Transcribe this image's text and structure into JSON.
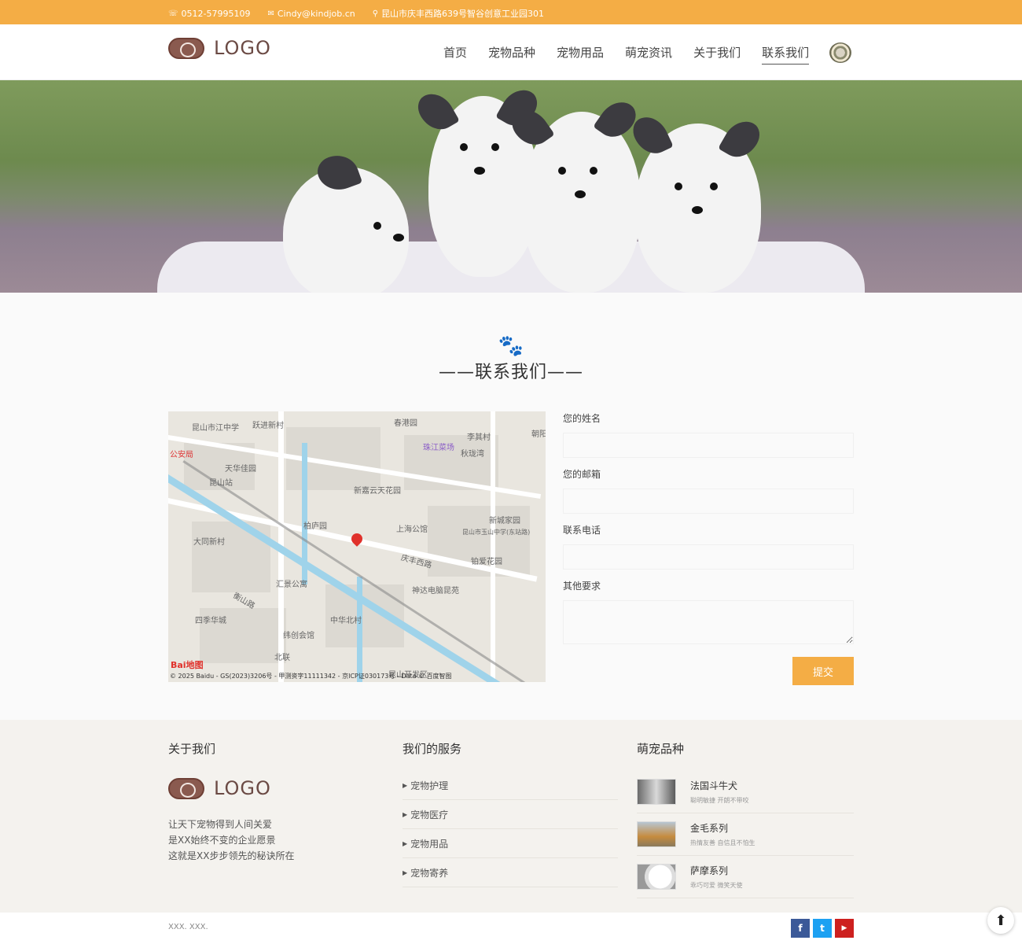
{
  "topbar": {
    "phone": "0512-57995109",
    "email": "Cindy@kindjob.cn",
    "address": "昆山市庆丰西路639号智谷创意工业园301",
    "phone_icon": "phone-icon",
    "email_icon": "mail-icon",
    "address_icon": "map-marker-icon"
  },
  "header": {
    "logo_text": "LOGO",
    "nav": [
      {
        "label": "首页"
      },
      {
        "label": "宠物品种"
      },
      {
        "label": "宠物用品"
      },
      {
        "label": "萌宠资讯"
      },
      {
        "label": "关于我们"
      },
      {
        "label": "联系我们",
        "active": true
      }
    ]
  },
  "section": {
    "title": "——联系我们——",
    "icon": "paw-icon"
  },
  "map": {
    "labels": [
      "昆山市江中学",
      "跃进新村",
      "春港园",
      "李其村",
      "朝阳",
      "公安局",
      "天华佳园",
      "秋珑湾",
      "珠江菜场",
      "昆山站",
      "新嘉云天花园",
      "柏庐园",
      "上海公馆",
      "新城家园",
      "大同新村",
      "庆丰西路",
      "昆山市玉山中学(东站路)",
      "铂爱花园",
      "汇景公寓",
      "神达电脑昆苑",
      "衡山路",
      "四季华城",
      "中华北村",
      "纬创会馆",
      "北联",
      "昆山开发区"
    ],
    "copyright": "© 2025 Baidu - GS(2023)3206号 - 甲测资字11111342 - 京ICP证030173号 - Data © 百度智图",
    "brand": "Bai地图"
  },
  "form": {
    "name_label": "您的姓名",
    "email_label": "您的邮箱",
    "phone_label": "联系电话",
    "other_label": "其他要求",
    "name_value": "",
    "email_value": "",
    "phone_value": "",
    "other_value": "",
    "submit_label": "提交"
  },
  "footer": {
    "about": {
      "title": "关于我们",
      "logo_text": "LOGO",
      "lines": [
        "让天下宠物得到人间关爱",
        "是XX始终不变的企业愿景",
        "这就是XX步步领先的秘诀所在"
      ]
    },
    "services": {
      "title": "我们的服务",
      "items": [
        "宠物护理",
        "宠物医疗",
        "宠物用品",
        "宠物寄养"
      ]
    },
    "breeds": {
      "title": "萌宠品种",
      "items": [
        {
          "name": "法国斗牛犬",
          "desc": "聪明敏捷 开朗不带咬"
        },
        {
          "name": "金毛系列",
          "desc": "热情友善 自信且不怕生"
        },
        {
          "name": "萨摩系列",
          "desc": "乖巧可爱 微笑天使"
        }
      ]
    }
  },
  "bottom": {
    "copyright": "XXX. XXX.",
    "social": [
      {
        "icon": "facebook-icon",
        "glyph": "f",
        "color": "#3b5998"
      },
      {
        "icon": "twitter-icon",
        "glyph": "t",
        "color": "#1da1f2"
      },
      {
        "icon": "youtube-icon",
        "glyph": "▶",
        "color": "#cd201f"
      }
    ],
    "to_top_icon": "arrow-up-icon"
  }
}
